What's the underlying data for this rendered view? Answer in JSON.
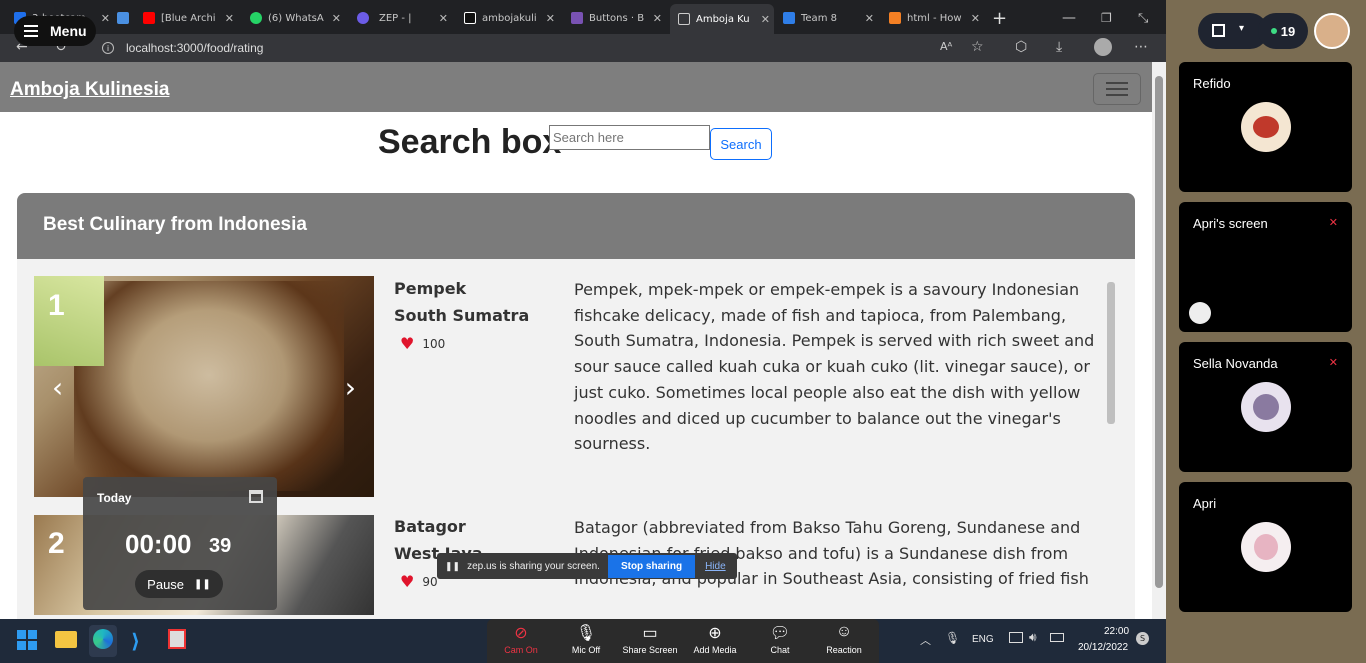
{
  "browser": {
    "tabs": [
      {
        "label": "3-bootcam",
        "color": "#1f6feb"
      },
      {
        "label": "",
        "color": "#4a90e2"
      },
      {
        "label": "[Blue Archi",
        "color": "#ff0000"
      },
      {
        "label": "(6) WhatsA",
        "color": "#25d366"
      },
      {
        "label": "ZEP - |",
        "color": "#6c5ce7"
      },
      {
        "label": "ambojakuli",
        "color": "#ffffff"
      },
      {
        "label": "Buttons · B",
        "color": "#7952b3"
      },
      {
        "label": "Amboja Ku",
        "color": "#cccccc"
      },
      {
        "label": "Team 8",
        "color": "#2f7ee8"
      },
      {
        "label": "html - How",
        "color": "#f48024"
      }
    ],
    "url": "localhost:3000/food/rating",
    "menu_label": "Menu"
  },
  "navbar": {
    "brand": "Amboja Kulinesia"
  },
  "search": {
    "title": "Search box",
    "placeholder": "Search here",
    "button": "Search"
  },
  "card": {
    "title": "Best Culinary from Indonesia"
  },
  "foods": [
    {
      "rank": "1",
      "name": "Pempek",
      "origin": "South Sumatra",
      "likes": "100",
      "description": "Pempek, mpek-mpek or empek-empek is a savoury Indonesian fishcake delicacy, made of fish and tapioca, from Palembang, South Sumatra, Indonesia. Pempek is served with rich sweet and sour sauce called kuah cuka or kuah cuko (lit. vinegar sauce), or just cuko. Sometimes local people also eat the dish with yellow noodles and diced up cucumber to balance out the vinegar's sourness."
    },
    {
      "rank": "2",
      "name": "Batagor",
      "origin": "West Java",
      "likes": "90",
      "description": "Batagor (abbreviated from Bakso Tahu Goreng, Sundanese and Indonesian for fried bakso and tofu) is a Sundanese dish from Indonesia, and popular in Southeast Asia, consisting of fried fish dumplings, usually served with peanut sauce."
    }
  ],
  "timer": {
    "label": "Today",
    "time": "00:00",
    "seconds": "39",
    "pause": "Pause"
  },
  "share": {
    "message": "zep.us is sharing your screen.",
    "stop": "Stop sharing",
    "hide": "Hide"
  },
  "meeting_bar": [
    {
      "label": "Cam On",
      "icon": "camera-off-icon"
    },
    {
      "label": "Mic Off",
      "icon": "mic-icon"
    },
    {
      "label": "Share Screen",
      "icon": "screen-icon"
    },
    {
      "label": "Add Media",
      "icon": "plus-icon"
    },
    {
      "label": "Chat",
      "icon": "chat-icon"
    },
    {
      "label": "Reaction",
      "icon": "smile-icon"
    }
  ],
  "tray": {
    "lang": "ENG",
    "time": "22:00",
    "date": "20/12/2022"
  },
  "participants": {
    "count": "19",
    "tiles": [
      {
        "name": "Refido"
      },
      {
        "name": "Apri's screen"
      },
      {
        "name": "Sella Novanda"
      },
      {
        "name": "Apri"
      }
    ]
  },
  "colors": {
    "accent": "#0d6efd",
    "navbar": "#7e7e7e",
    "heart": "#e0142c",
    "stop_sharing": "#1a73e8"
  }
}
